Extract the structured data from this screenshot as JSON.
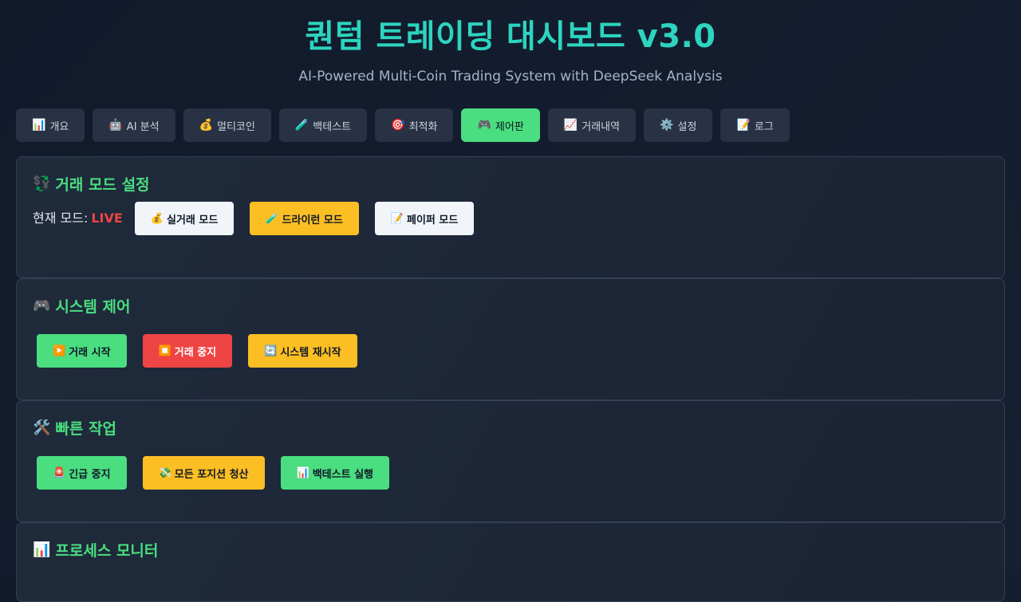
{
  "header": {
    "title": "퀀텀 트레이딩 대시보드 v3.0",
    "subtitle": "AI-Powered Multi-Coin Trading System with DeepSeek Analysis"
  },
  "tabs": [
    {
      "icon": "📊",
      "label": "개요",
      "active": false
    },
    {
      "icon": "🤖",
      "label": "AI 분석",
      "active": false
    },
    {
      "icon": "💰",
      "label": "멀티코인",
      "active": false
    },
    {
      "icon": "🧪",
      "label": "백테스트",
      "active": false
    },
    {
      "icon": "🎯",
      "label": "최적화",
      "active": false
    },
    {
      "icon": "🎮",
      "label": "제어판",
      "active": true
    },
    {
      "icon": "📈",
      "label": "거래내역",
      "active": false
    },
    {
      "icon": "⚙️",
      "label": "설정",
      "active": false
    },
    {
      "icon": "📝",
      "label": "로그",
      "active": false
    }
  ],
  "mode_section": {
    "icon": "💱",
    "title": "거래 모드 설정",
    "current_label": "현재 모드:",
    "current_value": "LIVE",
    "buttons": [
      {
        "icon": "💰",
        "label": "실거래 모드"
      },
      {
        "icon": "🧪",
        "label": "드라이런 모드"
      },
      {
        "icon": "📝",
        "label": "페이퍼 모드"
      }
    ]
  },
  "control_section": {
    "icon": "🎮",
    "title": "시스템 제어",
    "buttons": [
      {
        "icon": "▶️",
        "label": "거래 시작"
      },
      {
        "icon": "⏹️",
        "label": "거래 중지"
      },
      {
        "icon": "🔄",
        "label": "시스템 재시작"
      }
    ]
  },
  "quick_section": {
    "icon": "🛠️",
    "title": "빠른 작업",
    "buttons": [
      {
        "icon": "🚨",
        "label": "긴급 중지"
      },
      {
        "icon": "💸",
        "label": "모든 포지션 청산"
      },
      {
        "icon": "📊",
        "label": "백테스트 실행"
      }
    ]
  },
  "process_section": {
    "icon": "📊",
    "title": "프로세스 모니터"
  },
  "colors": {
    "accent_title": "#2dd4bf",
    "accent_green": "#4ade80",
    "yellow": "#fbbf24",
    "red": "#ef4444",
    "background": "#111a2b"
  }
}
